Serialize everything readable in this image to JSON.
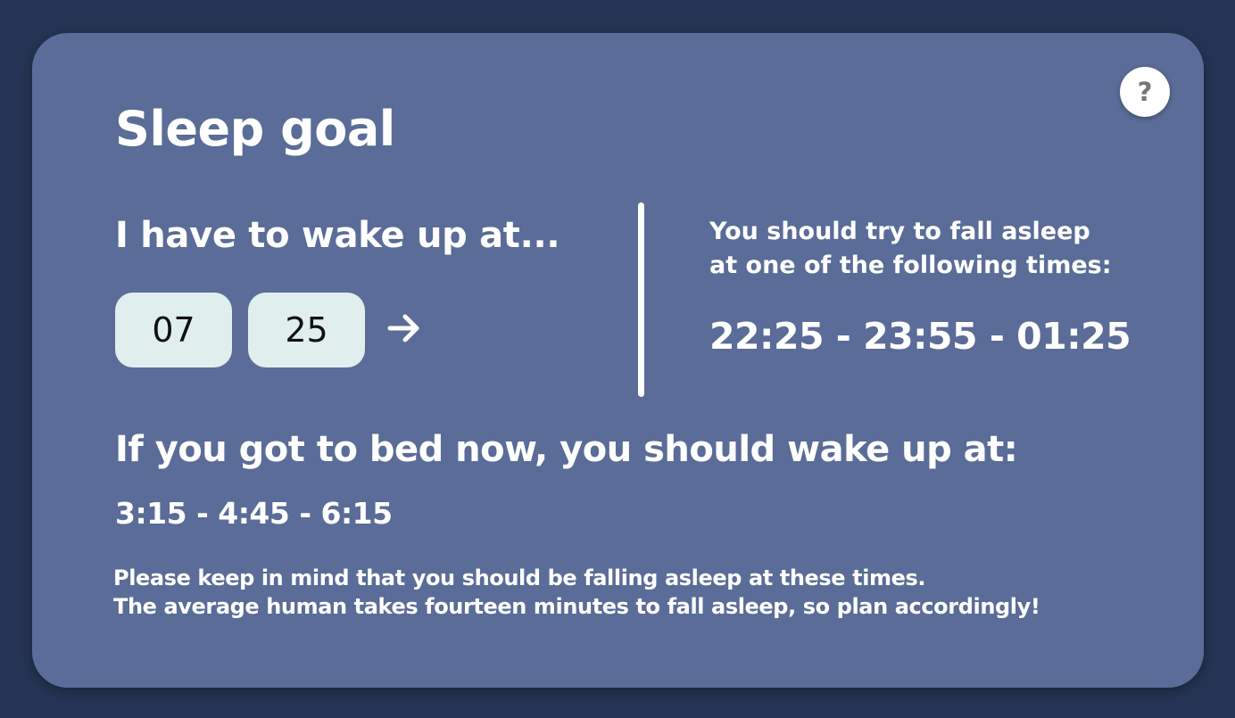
{
  "card": {
    "title": "Sleep goal",
    "help_label": "?"
  },
  "wake_section": {
    "heading": "I have to wake up at...",
    "hour_value": "07",
    "minute_value": "25",
    "submit_icon": "arrow-right-icon"
  },
  "asleep_section": {
    "intro_line_1": "You should try to fall asleep",
    "intro_line_2": "at one of the following times:",
    "times": "22:25 - 23:55 - 01:25"
  },
  "bed_now_section": {
    "heading": "If you got to bed now, you should wake up at:",
    "times": "3:15 - 4:45 - 6:15"
  },
  "note": {
    "line_1": "Please keep in mind that you should be falling asleep at these times.",
    "line_2": "The average human takes fourteen minutes to fall asleep, so plan accordingly!"
  },
  "colors": {
    "page_background": "#263556",
    "card_background": "#5a6c97",
    "input_background": "#e0eeee",
    "text": "#ffffff",
    "help_icon": "#777777"
  }
}
